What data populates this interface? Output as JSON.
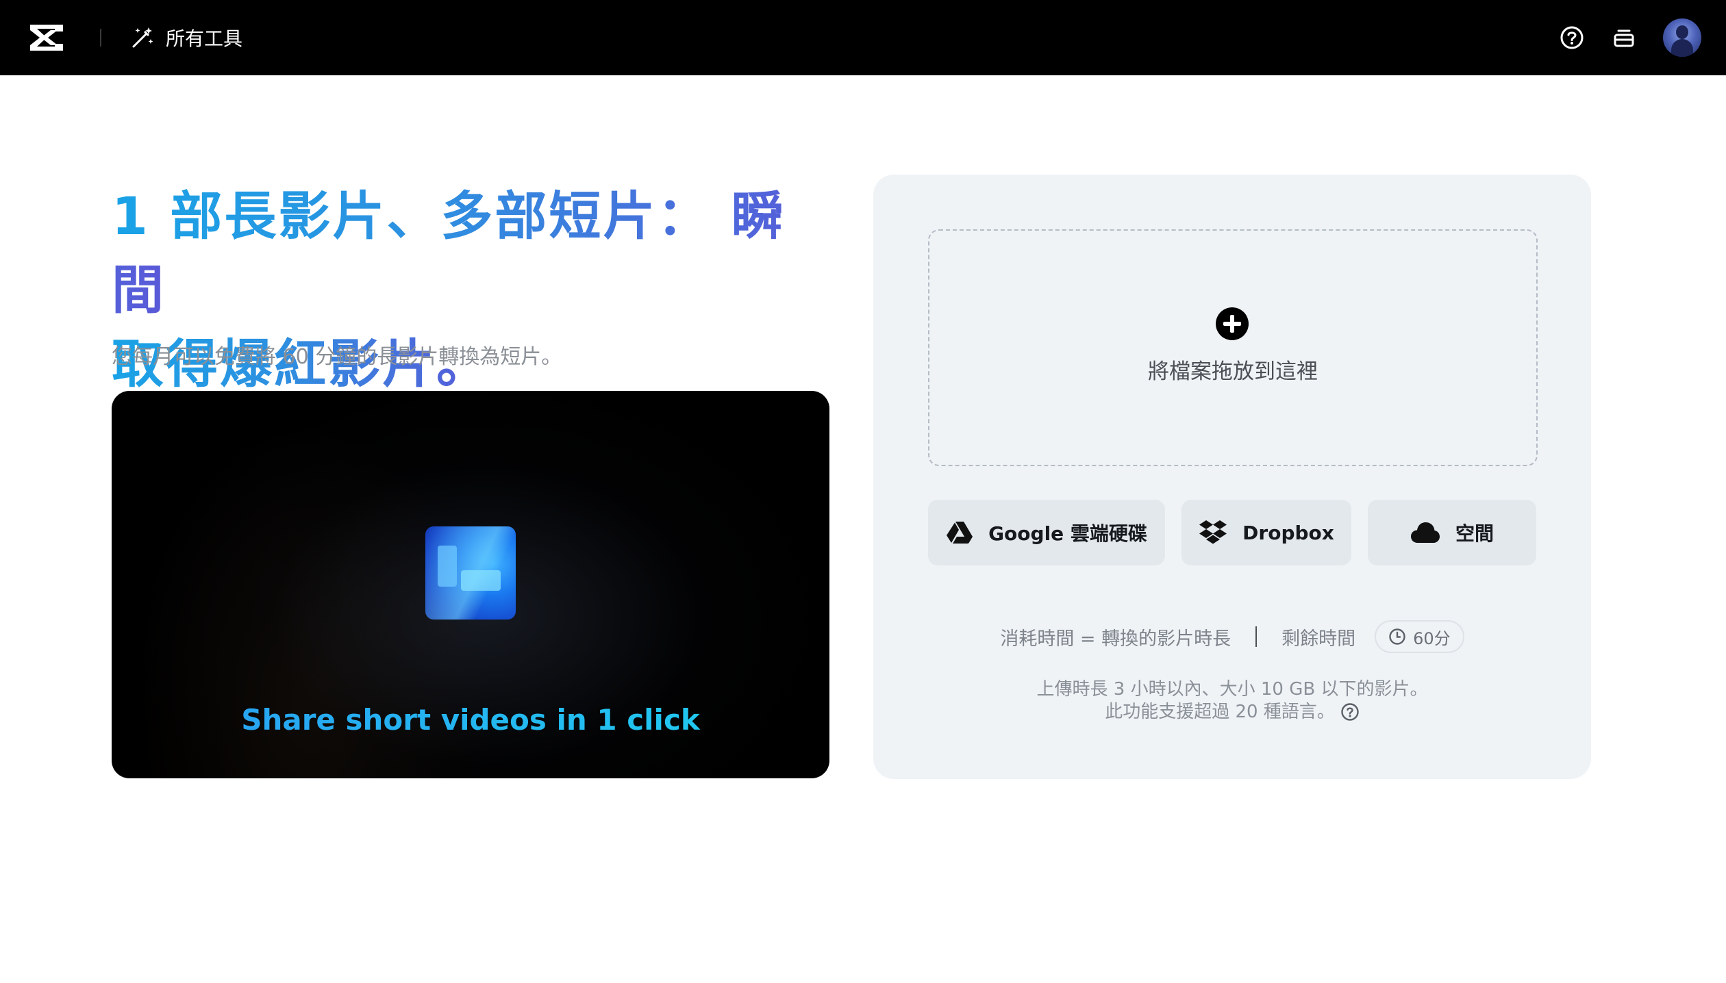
{
  "header": {
    "tools_label": "所有工具",
    "icons": [
      "capcut-logo-icon",
      "magic-wand-icon",
      "help-icon",
      "layers-icon",
      "avatar"
    ]
  },
  "hero": {
    "headline_line1": "1 部長影片、多部短片： 瞬間",
    "headline_line2": "取得爆紅影片。",
    "subtitle": "您每月可以免費將 60 分鐘的長影片轉換為短片。",
    "video_caption": "Share short videos in 1 click"
  },
  "upload": {
    "dropzone_label": "將檔案拖放到這裡",
    "buttons": [
      {
        "label": "Google 雲端硬碟",
        "icon": "google-drive-icon"
      },
      {
        "label": "Dropbox",
        "icon": "dropbox-icon"
      },
      {
        "label": "空間",
        "icon": "cloud-icon"
      }
    ],
    "usage_formula": "消耗時間 = 轉換的影片時長",
    "remaining_label": "剩餘時間",
    "remaining_value": "60分",
    "note_line1": "上傳時長 3 小時以內、大小 10 GB 以下的影片。",
    "note_line2": "此功能支援超過 20 種語言。"
  },
  "colors": {
    "topbar": "#000000",
    "headline_gradient": [
      "#1aa3e6",
      "#5a59d8"
    ],
    "panel_bg": "#f0f3f6",
    "button_bg": "#e3e8ed"
  }
}
